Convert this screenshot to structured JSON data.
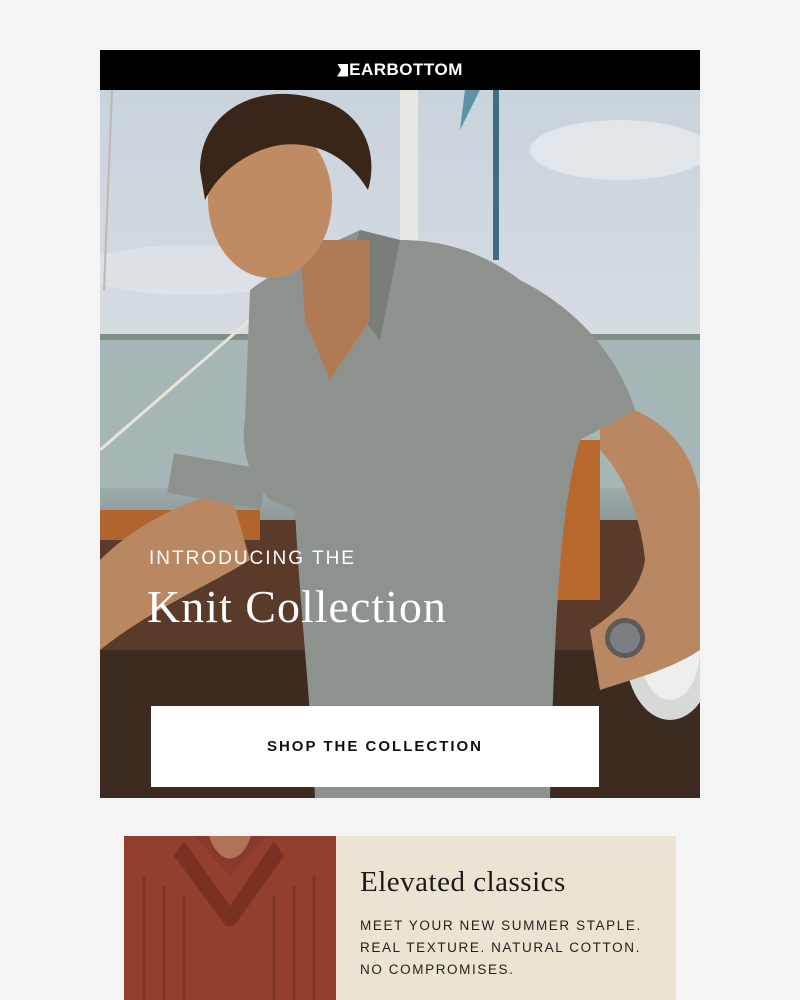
{
  "header": {
    "brand": "EARBOTTOM"
  },
  "hero": {
    "eyebrow": "INTRODUCING THE",
    "title": "Knit Collection",
    "cta_label": "SHOP THE COLLECTION"
  },
  "feature": {
    "title": "Elevated classics",
    "lines": [
      "MEET YOUR NEW SUMMER STAPLE.",
      "REAL TEXTURE. NATURAL COTTON.",
      "NO COMPROMISES."
    ]
  },
  "colors": {
    "header_bg": "#000000",
    "page_bg": "#f4f4f4",
    "feature_bg": "#ebe4d2",
    "cta_bg": "#ffffff"
  }
}
